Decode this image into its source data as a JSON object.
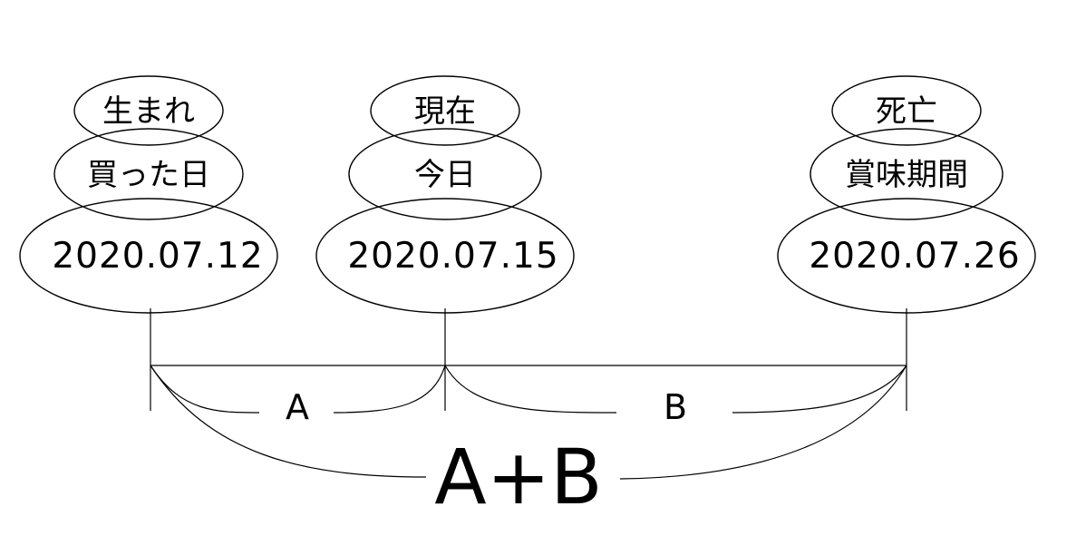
{
  "columns": [
    {
      "top_label": "生まれ",
      "mid_label": "買った日",
      "date": "2020.07.12"
    },
    {
      "top_label": "現在",
      "mid_label": "今日",
      "date": "2020.07.15"
    },
    {
      "top_label": "死亡",
      "mid_label": "賞味期間",
      "date": "2020.07.26"
    }
  ],
  "segments": {
    "a_label": "A",
    "b_label": "B",
    "total_label": "A+B"
  }
}
